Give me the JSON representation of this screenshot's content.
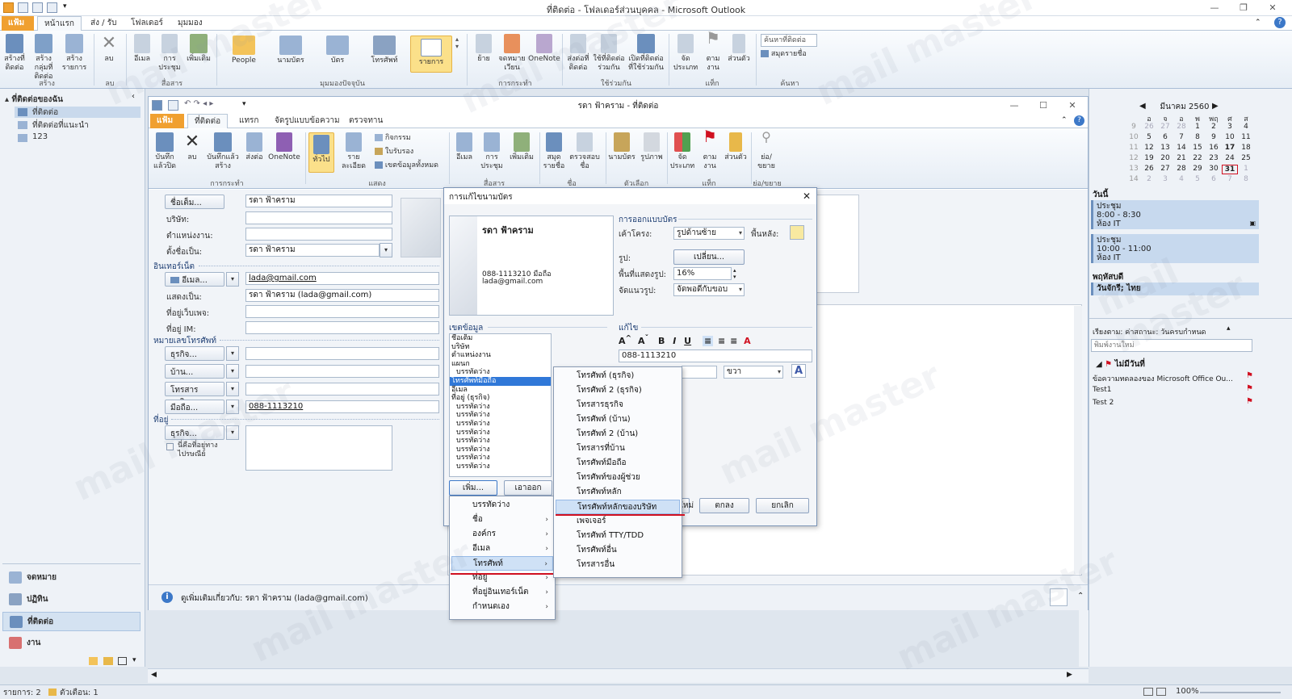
{
  "window": {
    "title": "ที่ติดต่อ - โฟลเดอร์ส่วนบุคคล - Microsoft Outlook"
  },
  "tabs": [
    "แฟ้ม",
    "หน้าแรก",
    "ส่ง / รับ",
    "โฟลเดอร์",
    "มุมมอง"
  ],
  "ribbon": {
    "buttons": {
      "new_contact": "สร้างที่ติดต่อ",
      "new_group": "สร้างกลุ่มที่ติดต่อ",
      "new_items": "สร้างรายการ",
      "delete": "ลบ",
      "email": "อีเมล",
      "meeting": "การประชุม",
      "more": "เพิ่มเติม",
      "people": "People",
      "business_card": "นามบัตร",
      "card": "บัตร",
      "phone": "โทรศัพท์",
      "list": "รายการ",
      "move": "ย้าย",
      "mail_merge": "จดหมายเวียน",
      "onenote": "OneNote",
      "forward_contact": "ส่งต่อที่ติดต่อ",
      "share_contacts": "ใช้ที่ติดต่อร่วมกัน",
      "open_shared": "เปิดที่ติดต่อที่ใช้ร่วมกัน",
      "categorize": "จัดประเภท",
      "follow_up": "ตามงาน",
      "private": "ส่วนตัว",
      "search_placeholder": "ค้นหาที่ติดต่อ",
      "address_book": "สมุดรายชื่อ"
    },
    "groups": [
      "สร้าง",
      "ลบ",
      "สื่อสาร",
      "มุมมองปัจจุบัน",
      "การกระทำ",
      "ใช้ร่วมกัน",
      "แท็ก",
      "ค้นหา"
    ]
  },
  "navpane": {
    "header": "ที่ติดต่อของฉัน",
    "folders": [
      "ที่ติดต่อ",
      "ที่ติดต่อที่แนะนำ",
      "123"
    ],
    "buttons": [
      "จดหมาย",
      "ปฏิทิน",
      "ที่ติดต่อ",
      "งาน"
    ]
  },
  "todobar": {
    "month": "มีนาคม 2560",
    "days_header": [
      "อ",
      "จ",
      "อ",
      "พ",
      "พฤ",
      "ศ",
      "ส"
    ],
    "weeks": [
      [
        "9",
        "26",
        "27",
        "28",
        "1",
        "2",
        "3",
        "4"
      ],
      [
        "10",
        "5",
        "6",
        "7",
        "8",
        "9",
        "10",
        "11"
      ],
      [
        "11",
        "12",
        "13",
        "14",
        "15",
        "16",
        "17",
        "18"
      ],
      [
        "12",
        "19",
        "20",
        "21",
        "22",
        "23",
        "24",
        "25"
      ],
      [
        "13",
        "26",
        "27",
        "28",
        "29",
        "30",
        "31",
        "1"
      ],
      [
        "14",
        "2",
        "3",
        "4",
        "5",
        "6",
        "7",
        "8"
      ]
    ],
    "section_today": "วันนี้",
    "appointments": [
      {
        "title": "ประชุม",
        "time": "8:00 - 8:30",
        "place": "ห้อง IT"
      },
      {
        "title": "ประชุม",
        "time": "10:00 - 11:00",
        "place": "ห้อง IT"
      }
    ],
    "section_thursday": "พฤหัสบดี",
    "holiday": "วันจักรี; ไทย",
    "tasks_header": "เรียงตาม: ค่าสถานะ: วันครบกำหนด",
    "task_placeholder": "พิมพ์งานใหม่",
    "task_group": "ไม่มีวันที่",
    "tasks": [
      "ข้อความทดลองของ Microsoft Office Ou...",
      "Test1",
      "Test 2"
    ]
  },
  "contact_window": {
    "title": "รดา ฟ้าคราม - ที่ติดต่อ",
    "tabs": [
      "แฟ้ม",
      "ที่ติดต่อ",
      "แทรก",
      "จัดรูปแบบข้อความ",
      "ตรวจทาน"
    ],
    "ribbon": {
      "save_close": "บันทึกแล้วปิด",
      "delete": "ลบ",
      "save_new": "บันทึกแล้วสร้าง",
      "send": "ส่งต่อ",
      "onenote": "OneNote",
      "general": "ทั่วไป",
      "details": "รายละเอียด",
      "activities": "กิจกรรม",
      "certificates": "ใบรับรอง",
      "all_fields": "เขตข้อมูลทั้งหมด",
      "email": "อีเมล",
      "meeting": "การประชุม",
      "more": "เพิ่มเติม",
      "address_book": "สมุดรายชื่อ",
      "check_names": "ตรวจสอบชื่อ",
      "business_card": "นามบัตร",
      "picture": "รูปภาพ",
      "categorize": "จัดประเภท",
      "follow_up": "ตามงาน",
      "private": "ส่วนตัว",
      "zoom": "ย่อ/ขยาย",
      "groups": [
        "การกระทำ",
        "แสดง",
        "สื่อสาร",
        "ชื่อ",
        "ตัวเลือก",
        "แท็ก",
        "ย่อ/ขยาย"
      ]
    },
    "form": {
      "full_name_btn": "ชื่อเต็ม...",
      "full_name": "รดา ฟ้าคราม",
      "company_lbl": "บริษัท:",
      "job_lbl": "ตำแหน่งงาน:",
      "file_as_lbl": "ตั้งชื่อเป็น:",
      "file_as": "รดา ฟ้าคราม",
      "internet_section": "อินเทอร์เน็ต",
      "email_btn": "อีเมล...",
      "email": "lada@gmail.com",
      "display_as_lbl": "แสดงเป็น:",
      "display_as": "รดา ฟ้าคราม (lada@gmail.com)",
      "webpage_lbl": "ที่อยู่เว็บเพจ:",
      "im_lbl": "ที่อยู่ IM:",
      "phone_section": "หมายเลขโทรศัพท์",
      "phone_business": "ธุรกิจ...",
      "phone_home": "บ้าน...",
      "phone_fax": "โทรสารธุรกิจ...",
      "phone_mobile": "มือถือ...",
      "mobile_number": "088-1113210",
      "address_section": "ที่อยู่",
      "address_business": "ธุรกิจ...",
      "mailing_check": "นี่คือที่อยู่ทางไปรษณีย์"
    },
    "footer": "ดูเพิ่มเติมเกี่ยวกับ: รดา ฟ้าคราม (lada@gmail.com)"
  },
  "dialog": {
    "title": "การแก้ไขนามบัตร",
    "card_name": "รดา ฟ้าคราม",
    "card_phone": "088-1113210 มือถือ",
    "card_email": "lada@gmail.com",
    "design_section": "การออกแบบบัตร",
    "layout_lbl": "เค้าโครง:",
    "layout_val": "รูปด้านซ้าย",
    "background_lbl": "พื้นหลัง:",
    "image_lbl": "รูป:",
    "change_btn": "เปลี่ยน...",
    "image_area_lbl": "พื้นที่แสดงรูป:",
    "image_area_val": "16%",
    "align_lbl": "จัดแนวรูป:",
    "align_val": "จัดพอดีกับขอบ",
    "fields_section": "เขตข้อมูล",
    "fields": [
      "ชื่อเต็ม",
      "บริษัท",
      "ตำแหน่งงาน",
      "แผนก",
      "บรรทัดว่าง",
      "โทรศัพท์มือถือ",
      "อีเมล",
      "ที่อยู่ (ธุรกิจ)",
      "บรรทัดว่าง",
      "บรรทัดว่าง",
      "บรรทัดว่าง",
      "บรรทัดว่าง",
      "บรรทัดว่าง",
      "บรรทัดว่าง",
      "บรรทัดว่าง",
      "บรรทัดว่าง"
    ],
    "edit_section": "แก้ไข",
    "edit_value": "088-1113210",
    "edit_align": "ขวา",
    "add_btn": "เพิ่ม...",
    "remove_btn": "เอาออก",
    "reset_btn": "ใหม่",
    "ok_btn": "ตกลง",
    "cancel_btn": "ยกเลิก"
  },
  "add_menu": {
    "items": [
      "บรรทัดว่าง",
      "ชื่อ",
      "องค์กร",
      "อีเมล",
      "โทรศัพท์",
      "ที่อยู่",
      "ที่อยู่อินเทอร์เน็ต",
      "กำหนดเอง"
    ]
  },
  "phone_menu": {
    "items": [
      "โทรศัพท์ (ธุรกิจ)",
      "โทรศัพท์ 2 (ธุรกิจ)",
      "โทรสารธุรกิจ",
      "โทรศัพท์ (บ้าน)",
      "โทรศัพท์ 2 (บ้าน)",
      "โทรสารที่บ้าน",
      "โทรศัพท์มือถือ",
      "โทรศัพท์ของผู้ช่วย",
      "โทรศัพท์หลัก",
      "โทรศัพท์หลักของบริษัท",
      "เพจเจอร์",
      "โทรศัพท์ TTY/TDD",
      "โทรศัพท์อื่น",
      "โทรสารอื่น"
    ]
  },
  "statusbar": {
    "items": "รายการ: 2",
    "reminders": "ตัวเตือน: 1",
    "zoom": "100%"
  },
  "watermark": "mail master"
}
